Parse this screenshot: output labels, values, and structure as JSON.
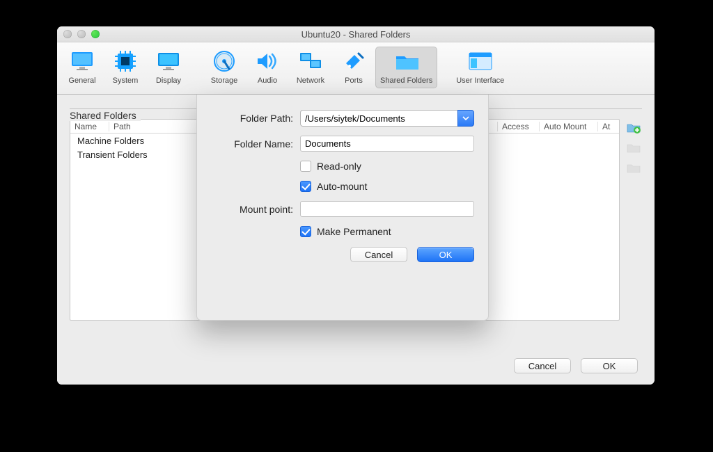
{
  "window": {
    "title": "Ubuntu20 - Shared Folders"
  },
  "toolbar": {
    "general": "General",
    "system": "System",
    "display": "Display",
    "storage": "Storage",
    "audio": "Audio",
    "network": "Network",
    "ports": "Ports",
    "shared_folders": "Shared Folders",
    "user_interface": "User Interface",
    "selected": "shared_folders"
  },
  "section": {
    "title": "Shared Folders",
    "columns": {
      "name": "Name",
      "path": "Path",
      "access": "Access",
      "auto_mount": "Auto Mount",
      "at": "At"
    },
    "rows": [
      {
        "label": "Machine Folders"
      },
      {
        "label": "Transient Folders"
      }
    ]
  },
  "side": {
    "add_icon": "add-folder-icon",
    "edit_icon": "edit-folder-icon",
    "remove_icon": "remove-folder-icon"
  },
  "main_buttons": {
    "cancel": "Cancel",
    "ok": "OK"
  },
  "sheet": {
    "folder_path_label": "Folder Path:",
    "folder_path_value": "/Users/siytek/Documents",
    "folder_name_label": "Folder Name:",
    "folder_name_value": "Documents",
    "read_only": {
      "label": "Read-only",
      "checked": false
    },
    "auto_mount": {
      "label": "Auto-mount",
      "checked": true
    },
    "mount_point_label": "Mount point:",
    "mount_point_value": "",
    "make_permanent": {
      "label": "Make Permanent",
      "checked": true
    },
    "cancel": "Cancel",
    "ok": "OK"
  }
}
